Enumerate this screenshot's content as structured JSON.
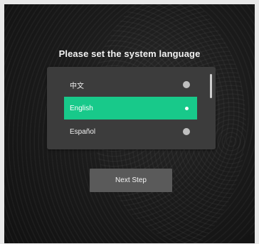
{
  "title": "Please set the system language",
  "languages": [
    {
      "label": "中文",
      "selected": false
    },
    {
      "label": "English",
      "selected": true
    },
    {
      "label": "Español",
      "selected": false
    }
  ],
  "next_button": "Next Step",
  "colors": {
    "accent": "#18c98a",
    "panel": "#3c3c3c",
    "background": "#1b1b1b"
  }
}
